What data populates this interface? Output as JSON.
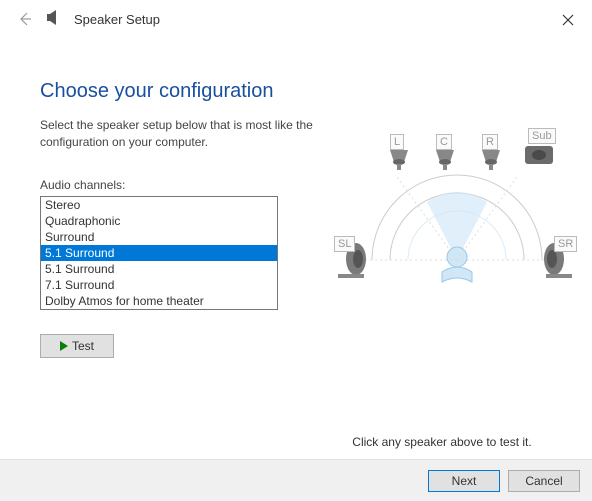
{
  "window": {
    "title": "Speaker Setup"
  },
  "heading": "Choose your configuration",
  "description": "Select the speaker setup below that is most like the configuration on your computer.",
  "channels": {
    "label": "Audio channels:",
    "options": [
      "Stereo",
      "Quadraphonic",
      "Surround",
      "5.1 Surround",
      "5.1 Surround",
      "7.1 Surround",
      "Dolby Atmos for home theater"
    ],
    "selected_index": 3
  },
  "test_button": "Test",
  "hint": "Click any speaker above to test it.",
  "buttons": {
    "next": "Next",
    "cancel": "Cancel"
  },
  "speakers": {
    "front_left": "L",
    "center": "C",
    "front_right": "R",
    "sub": "Sub",
    "side_left": "SL",
    "side_right": "SR"
  }
}
